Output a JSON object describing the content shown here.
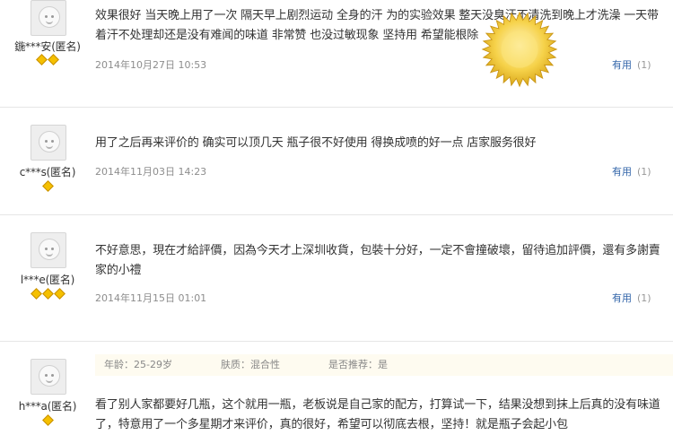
{
  "reviews": [
    {
      "user": "鍦***安(匿名)",
      "rank_diamonds": 2,
      "content": "效果很好 当天晚上用了一次 隔天早上剧烈运动 全身的汗 为的实验效果 整天没臭汗不清洗到晚上才洗澡 一天带着汗不处理却还是没有难闻的味道 非常赞 也没过敏现象 坚持用 希望能根除",
      "date": "2014年10月27日 10:53",
      "useful_label": "有用",
      "useful_count": "(1)"
    },
    {
      "user": "c***s(匿名)",
      "rank_diamonds": 1,
      "content": "用了之后再来评价的 确实可以顶几天 瓶子很不好使用 得换成喷的好一点 店家服务很好",
      "date": "2014年11月03日 14:23",
      "useful_label": "有用",
      "useful_count": "(1)"
    },
    {
      "user": "l***e(匿名)",
      "rank_diamonds": 3,
      "content": "不好意思，現在才給評價，因為今天才上深圳收貨，包裝十分好，一定不會撞破壞，留待追加評價，還有多謝賣家的小禮",
      "date": "2014年11月15日 01:01",
      "useful_label": "有用",
      "useful_count": "(1)"
    },
    {
      "user": "h***a(匿名)",
      "rank_diamonds": 1,
      "meta": {
        "age": "年龄：25-29岁",
        "skin": "肤质：混合性",
        "recommend": "是否推荐：是"
      },
      "content": "看了别人家都要好几瓶，这个就用一瓶，老板说是自己家的配方，打算试一下，结果没想到抹上后真的没有味道了，特意用了一个多星期才来评价，真的很好，希望可以彻底去根，坚持！就是瓶子会起小包"
    }
  ],
  "colors": {
    "diamond": "#f5c000",
    "useful_link": "#3366aa",
    "date": "#8d8d8d",
    "seal": "#f2c233"
  },
  "icons": {
    "avatar": "default-avatar-icon",
    "rank": "diamond-icon",
    "seal": "sunburst-seal-icon"
  }
}
